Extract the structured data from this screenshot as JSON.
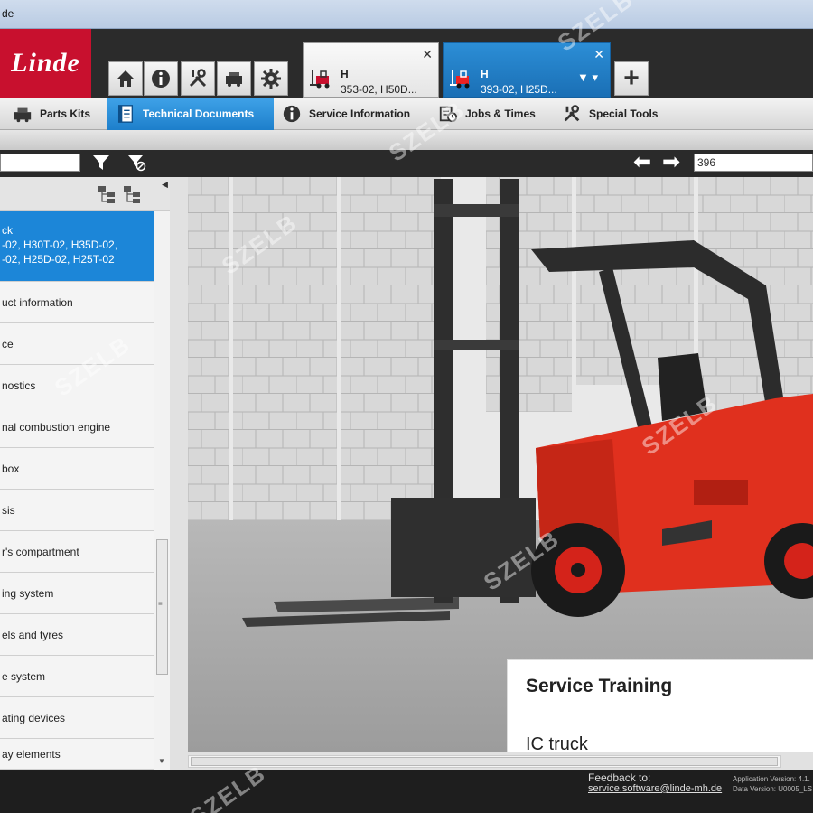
{
  "window": {
    "title": "de"
  },
  "brand": {
    "logo": "Linde"
  },
  "toolbar": [
    "home-icon",
    "info-icon",
    "tools-icon",
    "parts-icon",
    "settings-icon"
  ],
  "doc_tabs": [
    {
      "line1": "H",
      "line2": "353-02, H50D...",
      "close": "✕"
    },
    {
      "line1": "H",
      "line2": "393-02, H25D...",
      "close": "✕",
      "filter": "▼ ▾"
    }
  ],
  "add_tab": "+",
  "modules": [
    {
      "label": "Parts Kits",
      "icon": "parts-kits-icon"
    },
    {
      "label": "Technical Documents",
      "icon": "document-icon"
    },
    {
      "label": "Service Information",
      "icon": "info-icon"
    },
    {
      "label": "Jobs & Times",
      "icon": "jobs-icon"
    },
    {
      "label": "Special Tools",
      "icon": "tools-icon"
    }
  ],
  "search": {
    "value": ""
  },
  "nav": {
    "back": "⬅",
    "forward": "➡",
    "page": "396"
  },
  "tree": {
    "selected": "ck\n-02, H30T-02, H35D-02,\n-02, H25D-02, H25T-02",
    "items": [
      "uct information",
      "ce",
      "nostics",
      "nal combustion engine",
      "box",
      "sis",
      "r's compartment",
      "ing system",
      "els and tyres",
      "e system",
      "ating devices",
      "ay elements"
    ]
  },
  "document": {
    "title": "Service Training",
    "subtitle": "IC truck"
  },
  "footer": {
    "feedback_label": "Feedback to:",
    "feedback_email": "service.software@linde-mh.de",
    "app_version": "Application Version: 4.1.",
    "data_version": "Data Version: U0005_LS"
  },
  "watermark": "SZELB",
  "colors": {
    "brand_red": "#c8102e",
    "accent_blue": "#1c86d8"
  }
}
